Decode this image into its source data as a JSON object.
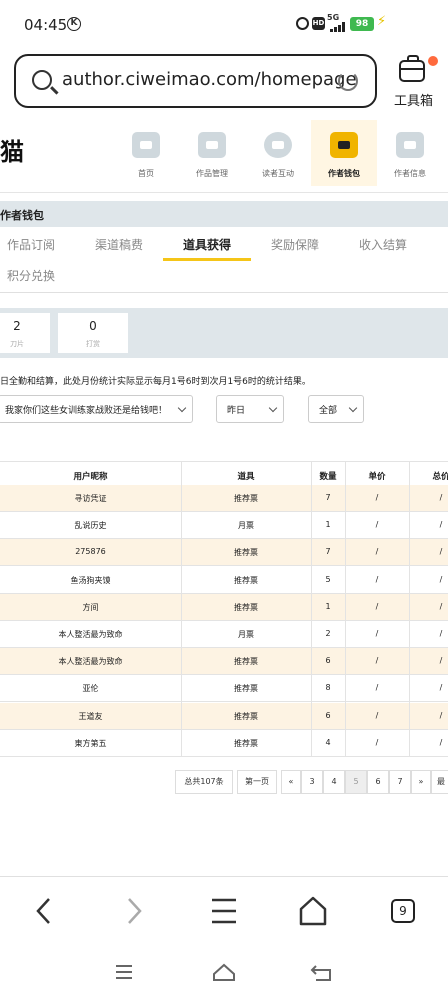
{
  "status_bar": {
    "time": "04:45",
    "k_badge": "K",
    "hd": "HD",
    "network": "5G",
    "battery": "98"
  },
  "browser": {
    "url": "author.ciweimao.com/homepage",
    "toolbox_label": "工具箱",
    "tab_count": "9"
  },
  "site": {
    "logo_fragment": "猫",
    "nav": [
      {
        "label": "首页",
        "icon": "house-icon",
        "active": false
      },
      {
        "label": "作品管理",
        "icon": "book-icon",
        "active": false
      },
      {
        "label": "读者互动",
        "icon": "chat-paw-icon",
        "active": false
      },
      {
        "label": "作者钱包",
        "icon": "wallet-icon",
        "active": true
      },
      {
        "label": "作者信息",
        "icon": "id-card-icon",
        "active": false
      }
    ],
    "section_title": "作者钱包"
  },
  "tabs": [
    {
      "label": "作品订阅",
      "active": false
    },
    {
      "label": "渠道稿费",
      "active": false
    },
    {
      "label": "道具获得",
      "active": true
    },
    {
      "label": "奖励保障",
      "active": false
    },
    {
      "label": "收入结算",
      "active": false
    },
    {
      "label": "积分兑换",
      "active": false
    }
  ],
  "stats": [
    {
      "value": "2",
      "label": "刀片"
    },
    {
      "value": "0",
      "label": "打赏"
    }
  ],
  "notice": "日全勤和结算，此处月份统计实际显示每月1号6时到次月1号6时的统计结果。",
  "filters": {
    "book": "我家你们这些女训练家战败还是给钱吧！",
    "date": "昨日",
    "type": "全部"
  },
  "table": {
    "columns": [
      "用户昵称",
      "道具",
      "数量",
      "单价",
      "总价"
    ],
    "rows": [
      [
        "寻访凭证",
        "推荐票",
        "7",
        "/",
        "/"
      ],
      [
        "乱说历史",
        "月票",
        "1",
        "/",
        "/"
      ],
      [
        "275876",
        "推荐票",
        "7",
        "/",
        "/"
      ],
      [
        "鱼汤狗夹馍",
        "推荐票",
        "5",
        "/",
        "/"
      ],
      [
        "方间",
        "推荐票",
        "1",
        "/",
        "/"
      ],
      [
        "本人整活最为致命",
        "月票",
        "2",
        "/",
        "/"
      ],
      [
        "本人整活最为致命",
        "推荐票",
        "6",
        "/",
        "/"
      ],
      [
        "亚伦",
        "推荐票",
        "8",
        "/",
        "/"
      ],
      [
        "王道友",
        "推荐票",
        "6",
        "/",
        "/"
      ],
      [
        "東方第五",
        "推荐票",
        "4",
        "/",
        "/"
      ]
    ]
  },
  "pagination": {
    "total": "总共107条",
    "first": "第一页",
    "prev": "«",
    "pages": [
      "3",
      "4",
      "5",
      "6",
      "7"
    ],
    "current": "5",
    "next": "»",
    "last": "最"
  }
}
